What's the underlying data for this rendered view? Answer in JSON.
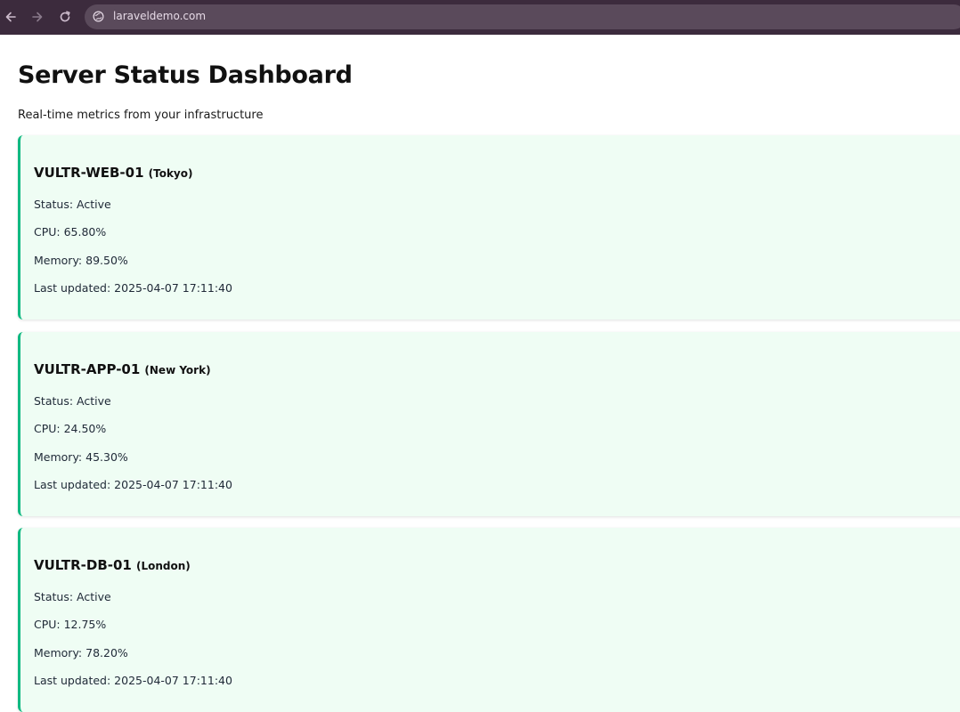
{
  "browser": {
    "url": "laraveldemo.com",
    "back_icon": "arrow-left-icon",
    "forward_icon": "arrow-right-icon",
    "reload_icon": "reload-icon",
    "site_info_icon": "globe-icon"
  },
  "header": {
    "title": "Server Status Dashboard",
    "subtitle": "Real-time metrics from your infrastructure"
  },
  "colors": {
    "card_background": "#effdf4",
    "card_accent": "#10b981",
    "browser_chrome": "#3c2b3d"
  },
  "servers": [
    {
      "name": "VULTR-WEB-01",
      "location": "(Tokyo)",
      "status": "Status: Active",
      "cpu": "CPU: 65.80%",
      "memory": "Memory: 89.50%",
      "updated": "Last updated: 2025-04-07 17:11:40"
    },
    {
      "name": "VULTR-APP-01",
      "location": "(New York)",
      "status": "Status: Active",
      "cpu": "CPU: 24.50%",
      "memory": "Memory: 45.30%",
      "updated": "Last updated: 2025-04-07 17:11:40"
    },
    {
      "name": "VULTR-DB-01",
      "location": "(London)",
      "status": "Status: Active",
      "cpu": "CPU: 12.75%",
      "memory": "Memory: 78.20%",
      "updated": "Last updated: 2025-04-07 17:11:40"
    }
  ]
}
